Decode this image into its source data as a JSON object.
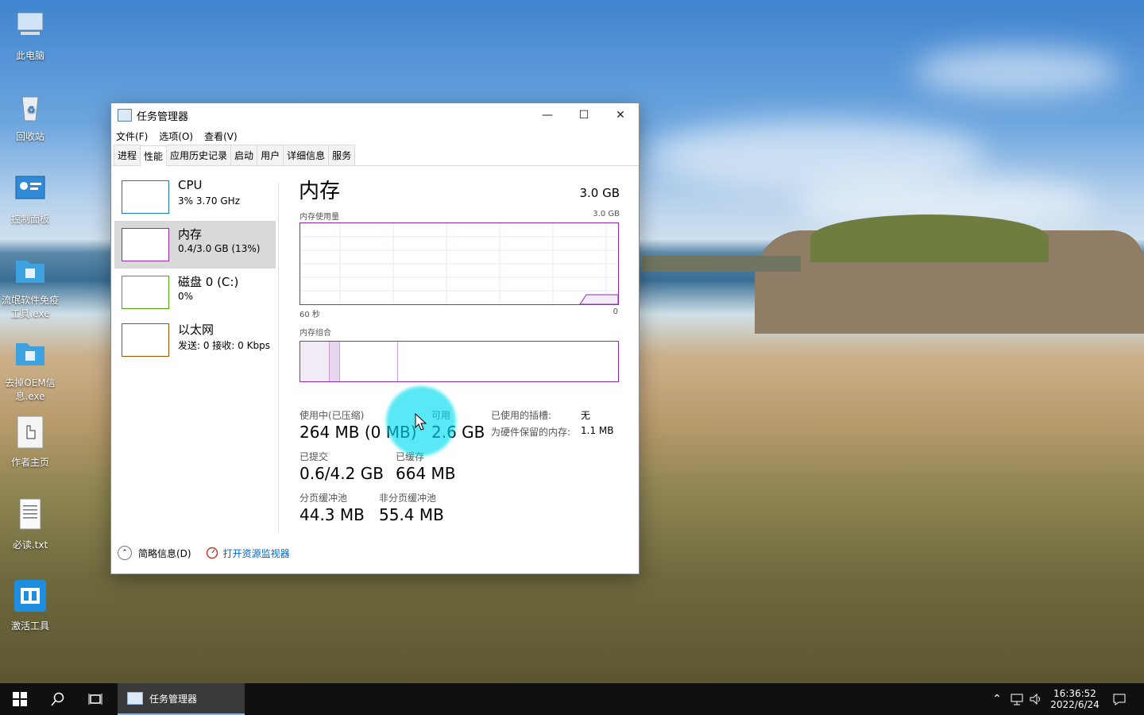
{
  "desktop": {
    "icons": [
      {
        "label": "此电脑",
        "icon": "computer-icon"
      },
      {
        "label": "回收站",
        "icon": "recycle-bin-icon"
      },
      {
        "label": "控制面板",
        "icon": "control-panel-icon"
      },
      {
        "label": "流氓软件免疫工具.exe",
        "icon": "app-folder-icon"
      },
      {
        "label": "去掉OEM信息.exe",
        "icon": "app-folder-icon"
      },
      {
        "label": "作者主页",
        "icon": "hand-pointer-icon"
      },
      {
        "label": "必读.txt",
        "icon": "text-file-icon"
      },
      {
        "label": "激活工具",
        "icon": "activation-tool-icon"
      }
    ]
  },
  "window": {
    "title": "任务管理器",
    "controls": {
      "minimize": "—",
      "maximize": "☐",
      "close": "✕"
    },
    "menu": [
      "文件(F)",
      "选项(O)",
      "查看(V)"
    ],
    "tabs": [
      "进程",
      "性能",
      "应用历史记录",
      "启动",
      "用户",
      "详细信息",
      "服务"
    ],
    "active_tab": "性能",
    "sidebar": [
      {
        "title": "CPU",
        "sub": "3%  3.70 GHz",
        "color": "#1779ba"
      },
      {
        "title": "内存",
        "sub": "0.4/3.0 GB (13%)",
        "color": "#9528b4"
      },
      {
        "title": "磁盘 0 (C:)",
        "sub": "0%",
        "color": "#4da60c"
      },
      {
        "title": "以太网",
        "sub": "发送: 0  接收: 0 Kbps",
        "color": "#a74f01"
      }
    ],
    "main": {
      "title": "内存",
      "total": "3.0 GB",
      "usage_label": "内存使用量",
      "usage_max": "3.0 GB",
      "time_left": "60 秒",
      "time_right": "0",
      "composition_label": "内存组合",
      "used_fraction": 0.13,
      "stats": {
        "in_use_label": "使用中(已压缩)",
        "in_use_value": "264 MB (0 MB)",
        "available_label": "可用",
        "available_value": "2.6 GB",
        "committed_label": "已提交",
        "committed_value": "0.6/4.2 GB",
        "cached_label": "已缓存",
        "cached_value": "664 MB",
        "paged_label": "分页缓冲池",
        "paged_value": "44.3 MB",
        "nonpaged_label": "非分页缓冲池",
        "nonpaged_value": "55.4 MB",
        "slots_label": "已使用的插槽:",
        "slots_value": "无",
        "reserved_label": "为硬件保留的内存:",
        "reserved_value": "1.1 MB"
      }
    },
    "footer": {
      "summary_label": "简略信息(D)",
      "monitor_label": "打开资源监视器"
    }
  },
  "taskbar": {
    "app_label": "任务管理器",
    "time": "16:36:52",
    "date": "2022/6/24"
  }
}
